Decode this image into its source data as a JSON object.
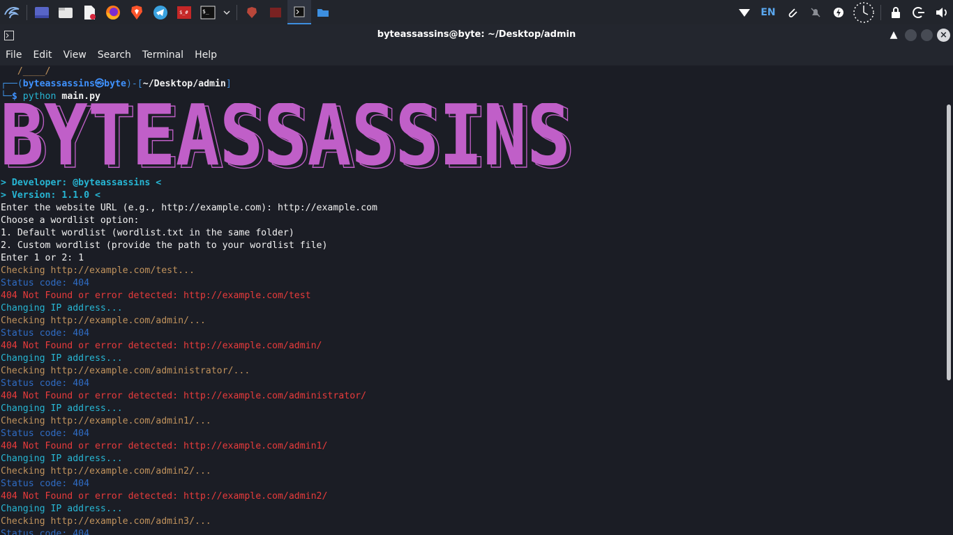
{
  "taskbar": {
    "launchers": [
      {
        "icon": "kali-menu-icon"
      },
      {
        "icon": "show-desktop-icon"
      },
      {
        "icon": "file-manager-icon"
      },
      {
        "icon": "text-editor-icon"
      },
      {
        "icon": "firefox-icon"
      },
      {
        "icon": "brave-icon"
      },
      {
        "icon": "telegram-icon"
      },
      {
        "icon": "burp-app-icon"
      },
      {
        "icon": "terminal-launcher-icon"
      }
    ],
    "windows": [
      {
        "icon": "brave-window-icon"
      },
      {
        "icon": "burp-window-icon"
      },
      {
        "icon": "terminal-window-icon",
        "active": true
      },
      {
        "icon": "folder-window-icon"
      }
    ],
    "tray": {
      "language": "EN",
      "icons": [
        "network-icon",
        "clip-icon",
        "notifications-muted-icon",
        "power-icon",
        "clock-icon",
        "lock-icon",
        "logout-icon",
        "volume-icon"
      ]
    },
    "accent": "#3d8fe0"
  },
  "window": {
    "title": "byteassassins@byte: ~/Desktop/admin"
  },
  "menu": [
    "File",
    "Edit",
    "View",
    "Search",
    "Terminal",
    "Help"
  ],
  "terminal": {
    "prompt": {
      "tail": "   /____/",
      "user": "byteassassins",
      "at": "㉿",
      "host": "byte",
      "path": "~/Desktop/admin",
      "command_bin": "python",
      "command_arg": "main.py"
    },
    "banner": {
      "text": "BYTEASSASSINS",
      "color": "#c05fc8"
    },
    "lines": [
      {
        "text": "> Developer: @byteassassins <",
        "color": "cyan",
        "bold": true
      },
      {
        "text": "> Version: 1.1.0 <",
        "color": "cyan",
        "bold": true
      },
      {
        "text": "Enter the website URL (e.g., http://example.com): http://example.com",
        "color": "white"
      },
      {
        "text": "Choose a wordlist option:",
        "color": "white"
      },
      {
        "text": "1. Default wordlist (wordlist.txt in the same folder)",
        "color": "white"
      },
      {
        "text": "2. Custom wordlist (provide the path to your wordlist file)",
        "color": "white"
      },
      {
        "text": "Enter 1 or 2: 1",
        "color": "white"
      },
      {
        "text": "Checking http://example.com/test...",
        "color": "orange"
      },
      {
        "text": "Status code: 404",
        "color": "blue"
      },
      {
        "text": "404 Not Found or error detected: http://example.com/test",
        "color": "red"
      },
      {
        "text": "Changing IP address...",
        "color": "cyan"
      },
      {
        "text": "Checking http://example.com/admin/...",
        "color": "orange"
      },
      {
        "text": "Status code: 404",
        "color": "blue"
      },
      {
        "text": "404 Not Found or error detected: http://example.com/admin/",
        "color": "red"
      },
      {
        "text": "Changing IP address...",
        "color": "cyan"
      },
      {
        "text": "Checking http://example.com/administrator/...",
        "color": "orange"
      },
      {
        "text": "Status code: 404",
        "color": "blue"
      },
      {
        "text": "404 Not Found or error detected: http://example.com/administrator/",
        "color": "red"
      },
      {
        "text": "Changing IP address...",
        "color": "cyan"
      },
      {
        "text": "Checking http://example.com/admin1/...",
        "color": "orange"
      },
      {
        "text": "Status code: 404",
        "color": "blue"
      },
      {
        "text": "404 Not Found or error detected: http://example.com/admin1/",
        "color": "red"
      },
      {
        "text": "Changing IP address...",
        "color": "cyan"
      },
      {
        "text": "Checking http://example.com/admin2/...",
        "color": "orange"
      },
      {
        "text": "Status code: 404",
        "color": "blue"
      },
      {
        "text": "404 Not Found or error detected: http://example.com/admin2/",
        "color": "red"
      },
      {
        "text": "Changing IP address...",
        "color": "cyan"
      },
      {
        "text": "Checking http://example.com/admin3/...",
        "color": "orange"
      },
      {
        "text": "Status code: 404",
        "color": "blue"
      }
    ]
  }
}
